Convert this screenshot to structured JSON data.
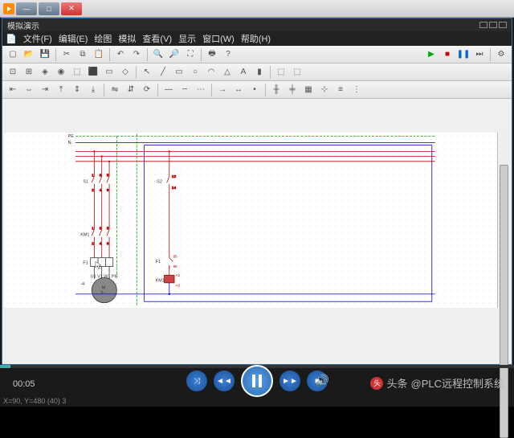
{
  "player": {
    "window_title": "",
    "time": "00:05",
    "watermark_prefix": "头条",
    "watermark_account": "@PLC远程控制系统",
    "logo_char": "头"
  },
  "app": {
    "title": "模拟演示",
    "coord_status": "X=90, Y=480 (40) 3"
  },
  "window_controls": {
    "min": "—",
    "max": "□",
    "close": "✕"
  },
  "menu": {
    "items": [
      "文件(F)",
      "编辑(E)",
      "绘图",
      "模拟",
      "查看(V)",
      "显示",
      "窗口(W)",
      "帮助(H)"
    ],
    "file_icon": "📄"
  },
  "schematic": {
    "labels": {
      "PE": "PE",
      "N": "N",
      "S1": "S1",
      "S2": "S2",
      "KM1_top": "KM1",
      "KM1_bot": "KM1",
      "F1_left": "F1",
      "F1_right": "F1",
      "M": "M",
      "three_tilde": "3~",
      "minus4": "-4",
      "U1V1W1PE": "U1  V1  W1  PE",
      "A1": "A1",
      "A2": "A2"
    },
    "contact_nums": {
      "s1": [
        "1",
        "2",
        "3",
        "4",
        "5",
        "6"
      ],
      "s2": [
        "13",
        "14"
      ],
      "km1": [
        "1",
        "2",
        "3",
        "4",
        "5",
        "6"
      ]
    }
  }
}
